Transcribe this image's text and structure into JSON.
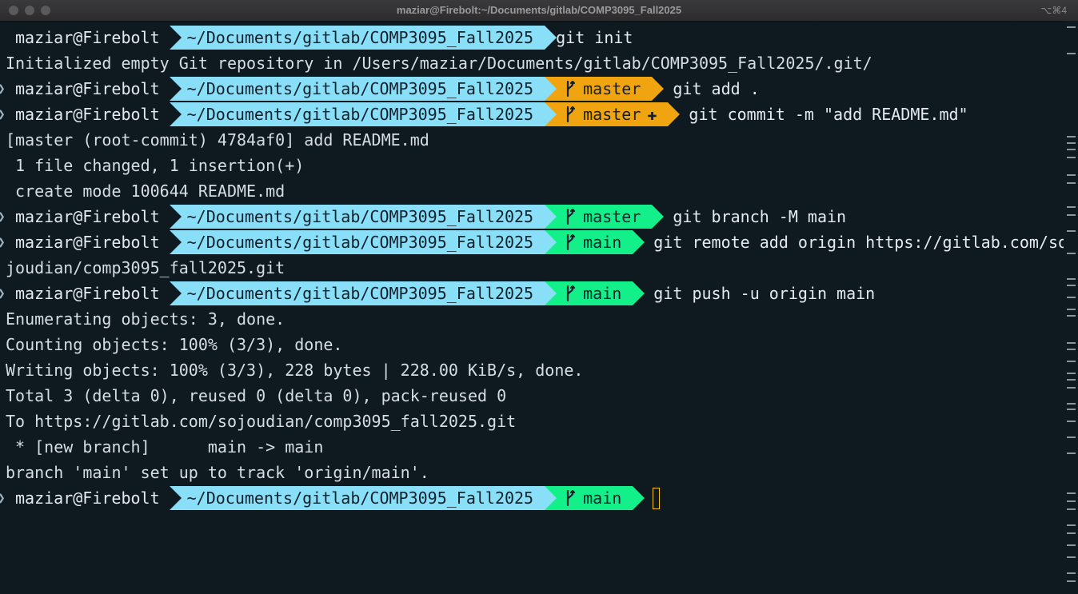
{
  "window": {
    "title": "maziar@Firebolt:~/Documents/gitlab/COMP3095_Fall2025",
    "shortcut": "⌥⌘4"
  },
  "prompt": {
    "user": "maziar@Firebolt",
    "dir": "~/Documents/gitlab/COMP3095_Fall2025"
  },
  "lines": [
    {
      "type": "prompt",
      "caret": "",
      "git": null,
      "cmd": "git init"
    },
    {
      "type": "out",
      "text": "Initialized empty Git repository in /Users/maziar/Documents/gitlab/COMP3095_Fall2025/.git/"
    },
    {
      "type": "prompt",
      "caret": "❯",
      "git": {
        "branch": "master",
        "color": "orange",
        "plus": ""
      },
      "cmd": "git add ."
    },
    {
      "type": "prompt",
      "caret": "❯",
      "git": {
        "branch": "master",
        "color": "orange",
        "plus": "✚"
      },
      "cmd": "git commit -m \"add README.md\""
    },
    {
      "type": "out",
      "text": "[master (root-commit) 4784af0] add README.md"
    },
    {
      "type": "out",
      "text": " 1 file changed, 1 insertion(+)"
    },
    {
      "type": "out",
      "text": " create mode 100644 README.md"
    },
    {
      "type": "prompt",
      "caret": "❯",
      "git": {
        "branch": "master",
        "color": "green",
        "plus": ""
      },
      "cmd": "git branch -M main"
    },
    {
      "type": "prompt",
      "caret": "❯",
      "git": {
        "branch": "main",
        "color": "green",
        "plus": ""
      },
      "cmd": "git remote add origin https://gitlab.com/so"
    },
    {
      "type": "out",
      "text": "joudian/comp3095_fall2025.git"
    },
    {
      "type": "prompt",
      "caret": "❯",
      "git": {
        "branch": "main",
        "color": "green",
        "plus": ""
      },
      "cmd": "git push -u origin main"
    },
    {
      "type": "out",
      "text": "Enumerating objects: 3, done."
    },
    {
      "type": "out",
      "text": "Counting objects: 100% (3/3), done."
    },
    {
      "type": "out",
      "text": "Writing objects: 100% (3/3), 228 bytes | 228.00 KiB/s, done."
    },
    {
      "type": "out",
      "text": "Total 3 (delta 0), reused 0 (delta 0), pack-reused 0"
    },
    {
      "type": "out",
      "text": "To https://gitlab.com/sojoudian/comp3095_fall2025.git"
    },
    {
      "type": "out",
      "text": " * [new branch]      main -> main"
    },
    {
      "type": "out",
      "text": "branch 'main' set up to track 'origin/main'."
    },
    {
      "type": "prompt",
      "caret": "❯",
      "git": {
        "branch": "main",
        "color": "green",
        "plus": ""
      },
      "cmd": "",
      "cursor": true
    }
  ],
  "colors": {
    "background": "#0f1a20",
    "dir_segment": "#8adff8",
    "git_dirty": "#f0a510",
    "git_clean": "#13f08a",
    "cursor": "#f2c21b"
  },
  "icons": {
    "branch": "git-branch-icon"
  }
}
